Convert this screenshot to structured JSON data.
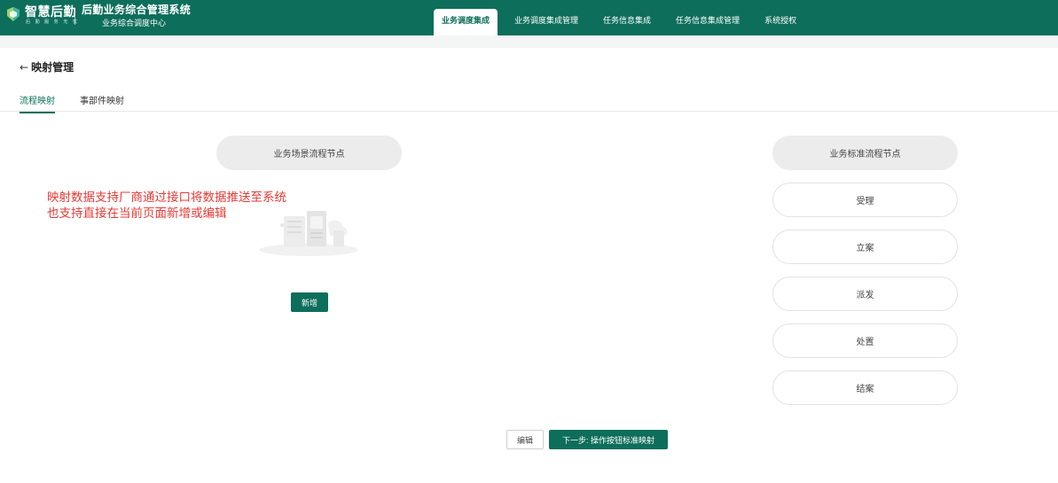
{
  "header": {
    "logo_text": "智慧后勤",
    "logo_subtext": "后 勤 服 务 无 忧",
    "system_title": "后勤业务综合管理系统",
    "system_subtitle": "业务综合调度中心",
    "brand_color": "#0d6e5b",
    "nav": [
      {
        "label": "业务调度集成",
        "active": true
      },
      {
        "label": "业务调度集成管理",
        "active": false
      },
      {
        "label": "任务信息集成",
        "active": false
      },
      {
        "label": "任务信息集成管理",
        "active": false
      },
      {
        "label": "系统授权",
        "active": false
      }
    ]
  },
  "page": {
    "back_icon": "arrow-left-icon",
    "back_glyph": "←",
    "title": "映射管理",
    "tabs": [
      {
        "label": "流程映射",
        "active": true
      },
      {
        "label": "事部件映射",
        "active": false
      }
    ]
  },
  "left_column": {
    "header": "业务场景流程节点",
    "empty_icon": "empty-data-illustration-icon",
    "add_button": "新增"
  },
  "annotation": {
    "color": "#e53935",
    "line1": "映射数据支持厂商通过接口将数据推送至系统",
    "line2": "也支持直接在当前页面新增或编辑"
  },
  "right_column": {
    "header": "业务标准流程节点",
    "nodes": [
      "受理",
      "立案",
      "派发",
      "处置",
      "结案"
    ]
  },
  "footer": {
    "edit_button": "编辑",
    "next_button": "下一步: 操作按钮标准映射"
  }
}
